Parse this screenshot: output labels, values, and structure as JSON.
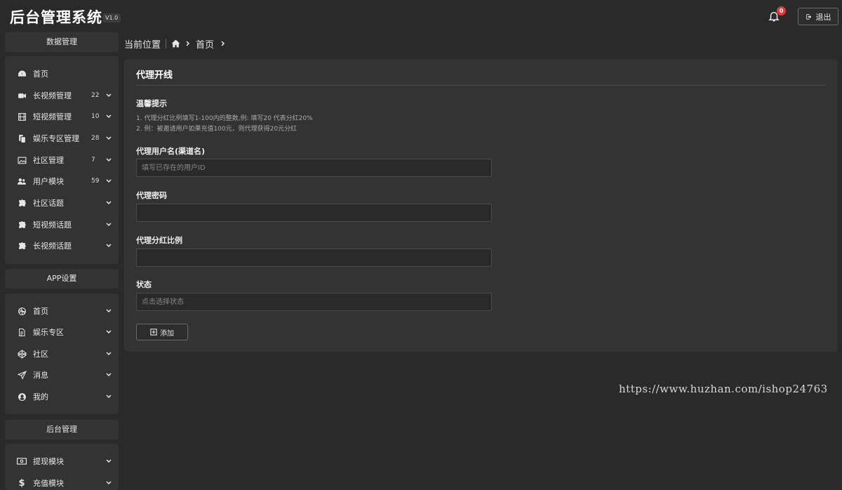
{
  "header": {
    "brand": "后台管理系统",
    "version": "V1.0",
    "notification_count": "0",
    "logout_label": "退出"
  },
  "sidebar": {
    "sections": [
      {
        "title": "数据管理",
        "items": [
          {
            "label": "首页",
            "icon": "dashboard-icon",
            "count": ""
          },
          {
            "label": "长视频管理",
            "icon": "video-camera-icon",
            "count": "22"
          },
          {
            "label": "短视频管理",
            "icon": "film-icon",
            "count": "10"
          },
          {
            "label": "娱乐专区管理",
            "icon": "copy-icon",
            "count": "28"
          },
          {
            "label": "社区管理",
            "icon": "image-icon",
            "count": "7"
          },
          {
            "label": "用户模块",
            "icon": "users-icon",
            "count": "59"
          },
          {
            "label": "社区话题",
            "icon": "puzzle-icon",
            "count": ""
          },
          {
            "label": "短视频话题",
            "icon": "puzzle-icon",
            "count": ""
          },
          {
            "label": "长视频话题",
            "icon": "puzzle-icon",
            "count": ""
          }
        ]
      },
      {
        "title": "APP设置",
        "items": [
          {
            "label": "首页",
            "icon": "dribbble-icon"
          },
          {
            "label": "娱乐专区",
            "icon": "file-icon"
          },
          {
            "label": "社区",
            "icon": "codepen-icon"
          },
          {
            "label": "消息",
            "icon": "paper-plane-icon"
          },
          {
            "label": "我的",
            "icon": "user-circle-icon"
          }
        ]
      },
      {
        "title": "后台管理",
        "items": [
          {
            "label": "提现模块",
            "icon": "money-icon"
          },
          {
            "label": "充值模块",
            "icon": "dollar-icon"
          }
        ]
      }
    ]
  },
  "breadcrumb": {
    "prefix": "当前位置",
    "home_icon": "home-icon",
    "current": "首页"
  },
  "form": {
    "title": "代理开线",
    "tip_title": "温馨提示",
    "tips": [
      "1. 代理分红比例填写1-100内的整数,例: 填写20 代表分红20%",
      "2. 例：被邀请用户如果充值100元，则代理获得20元分红"
    ],
    "fields": [
      {
        "label": "代理用户名(渠道名)",
        "value": "",
        "placeholder": "填写已存在的用户ID"
      },
      {
        "label": "代理密码",
        "value": "",
        "placeholder": ""
      },
      {
        "label": "代理分红比例",
        "value": "",
        "placeholder": ""
      },
      {
        "label": "状态",
        "value": "",
        "placeholder": "点击选择状态"
      }
    ],
    "submit_label": "添加"
  },
  "watermark": "https://www.huzhan.com/ishop24763"
}
